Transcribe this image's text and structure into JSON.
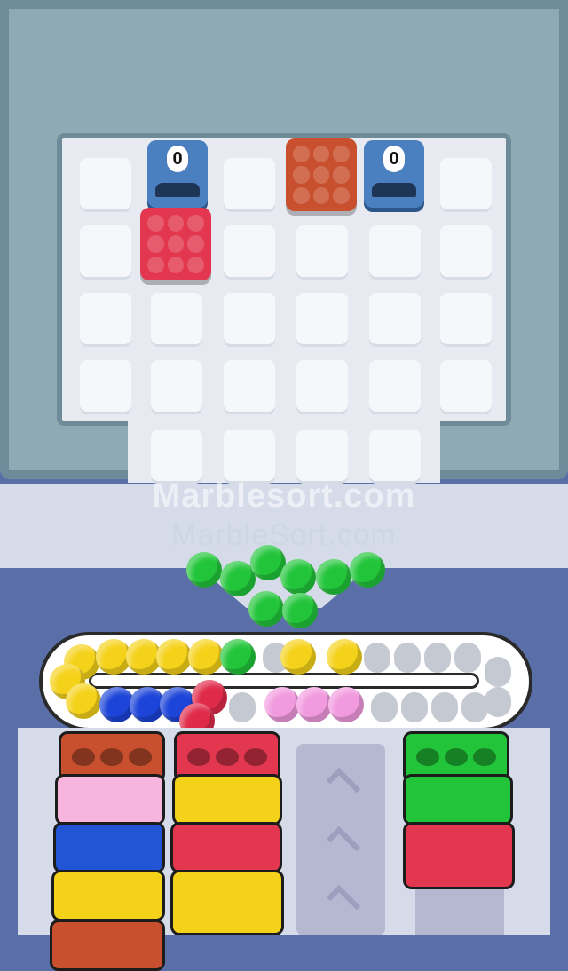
{
  "watermarks": [
    "Marblesort.com",
    "MarbleSort.com"
  ],
  "dispensers": [
    {
      "count": "0",
      "color": "#4a7fc0"
    },
    {
      "count": "0",
      "color": "#4a7fc0"
    }
  ],
  "blocks": [
    {
      "color": "#c8502e",
      "label": "orange-block"
    },
    {
      "color": "#e2374f",
      "label": "red-block"
    }
  ],
  "colors": {
    "green": "#22c53a",
    "yellow": "#f5d21a",
    "blue": "#1c44d8",
    "red": "#e02a4a",
    "pink": "#f29adf",
    "orange": "#c8502e",
    "board": "#e7eaf1",
    "frame": "#5a6fa8",
    "grey": "#8eaab5"
  },
  "marble_pile": [
    "green",
    "green",
    "green",
    "green",
    "green",
    "green",
    "green",
    "green"
  ],
  "track_top_row": [
    "yellow",
    "yellow",
    "yellow",
    "yellow",
    "yellow",
    "green",
    "empty",
    "yellow",
    "yellow"
  ],
  "track_bottom_row": [
    "yellow",
    "blue",
    "blue",
    "blue",
    "red",
    "red",
    "pink",
    "pink",
    "pink"
  ],
  "tubes": {
    "column1": [
      "orange",
      "pink",
      "blue",
      "yellow",
      "orange"
    ],
    "column2": [
      "red",
      "yellow",
      "red",
      "yellow"
    ],
    "column4": [
      "green",
      "green",
      "red"
    ]
  }
}
